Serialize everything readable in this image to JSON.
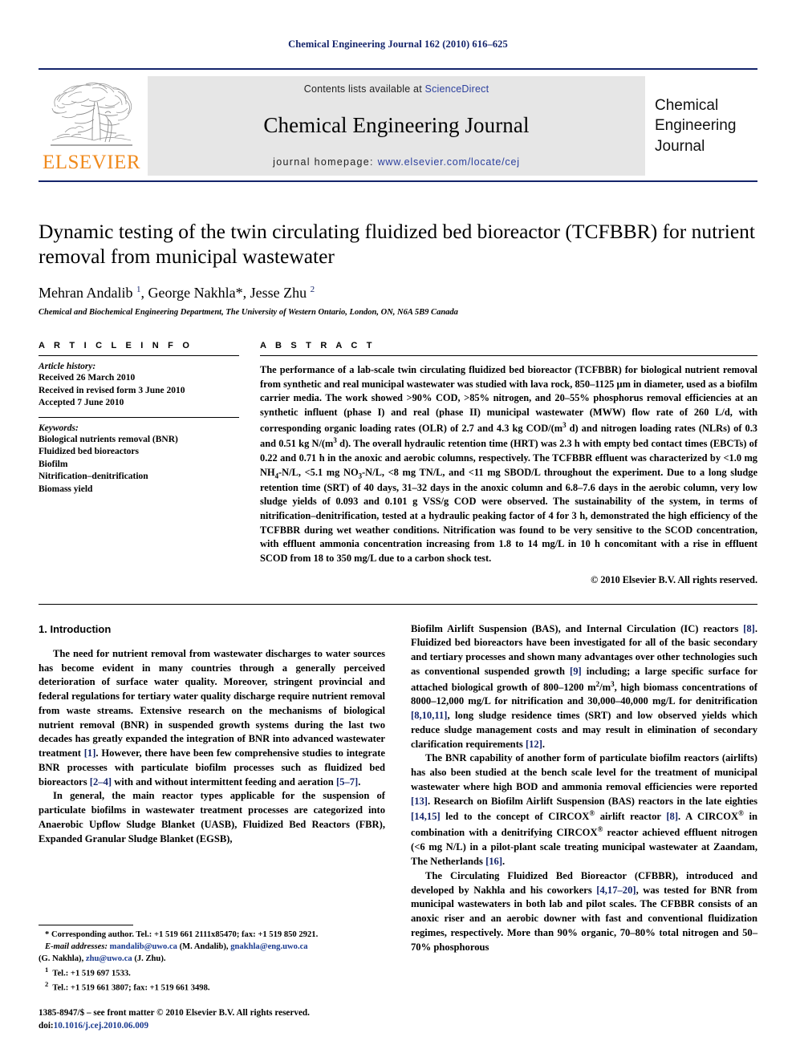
{
  "running_head": "Chemical Engineering Journal 162 (2010) 616–625",
  "masthead": {
    "contents_prefix": "Contents lists available at ",
    "sciencedirect": "ScienceDirect",
    "journal_title": "Chemical Engineering Journal",
    "homepage_prefix": "journal homepage: ",
    "homepage_url": "www.elsevier.com/locate/cej",
    "publisher_wordmark": "ELSEVIER",
    "cover_lines": [
      "Chemical",
      "Engineering",
      "Journal"
    ],
    "link_color": "#2b3f9e",
    "rule_color": "#14246b",
    "band_color": "#e6e6e6",
    "elsevier_orange": "#f08a1c"
  },
  "article": {
    "title": "Dynamic testing of the twin circulating fluidized bed bioreactor (TCFBBR) for nutrient removal from municipal wastewater",
    "authors_html": "Mehran Andalib <sup>1</sup>, George Nakhla<span class=\"star\">*</span>, Jesse Zhu <sup>2</sup>",
    "affiliation": "Chemical and Biochemical Engineering Department, The University of Western Ontario, London, ON, N6A 5B9 Canada"
  },
  "info": {
    "heading": "A R T I C L E    I N F O",
    "history_label": "Article history:",
    "history": [
      "Received 26 March 2010",
      "Received in revised form 3 June 2010",
      "Accepted 7 June 2010"
    ],
    "keywords_label": "Keywords:",
    "keywords": [
      "Biological nutrients removal (BNR)",
      "Fluidized bed bioreactors",
      "Biofilm",
      "Nitrification–denitrification",
      "Biomass yield"
    ]
  },
  "abstract": {
    "heading": "A B S T R A C T",
    "text_html": "The performance of a lab-scale twin circulating fluidized bed bioreactor (TCFBBR) for biological nutrient removal from synthetic and real municipal wastewater was studied with lava rock, 850–1125 μm in diameter, used as a biofilm carrier media. The work showed &gt;90% COD, &gt;85% nitrogen, and 20–55% phosphorus removal efficiencies at an synthetic influent (phase I) and real (phase II) municipal wastewater (MWW) flow rate of 260 L/d, with corresponding organic loading rates (OLR) of 2.7 and 4.3 kg COD/(m<sup class=\"s\">3</sup> d) and nitrogen loading rates (NLRs) of 0.3 and 0.51 kg N/(m<sup class=\"s\">3</sup> d). The overall hydraulic retention time (HRT) was 2.3 h with empty bed contact times (EBCTs) of 0.22 and 0.71 h in the anoxic and aerobic columns, respectively. The TCFBBR effluent was characterized by &lt;1.0 mg NH<sub>4</sub>-N/L, &lt;5.1 mg NO<sub>3</sub>-N/L, &lt;8 mg TN/L, and &lt;11 mg SBOD/L throughout the experiment. Due to a long sludge retention time (SRT) of 40 days, 31–32 days in the anoxic column and 6.8–7.6 days in the aerobic column, very low sludge yields of 0.093 and 0.101 g VSS/g COD were observed. The sustainability of the system, in terms of nitrification–denitrification, tested at a hydraulic peaking factor of 4 for 3 h, demonstrated the high efficiency of the TCFBBR during wet weather conditions. Nitrification was found to be very sensitive to the SCOD concentration, with effluent ammonia concentration increasing from 1.8 to 14 mg/L in 10 h concomitant with a rise in effluent SCOD from 18 to 350 mg/L due to a carbon shock test.",
    "copyright": "© 2010 Elsevier B.V. All rights reserved."
  },
  "body": {
    "section_title": "1.  Introduction",
    "left_paragraphs_html": [
      "The need for nutrient removal from wastewater discharges to water sources has become evident in many countries through a generally perceived deterioration of surface water quality. Moreover, stringent provincial and federal regulations for tertiary water quality discharge require nutrient removal from waste streams. Extensive research on the mechanisms of biological nutrient removal (BNR) in suspended growth systems during the last two decades has greatly expanded the integration of BNR into advanced wastewater treatment <span class=\"cite\">[1]</span>. However, there have been few comprehensive studies to integrate BNR processes with particulate biofilm processes such as fluidized bed bioreactors <span class=\"cite\">[2–4]</span> with and without intermittent feeding and aeration <span class=\"cite\">[5–7]</span>.",
      "In general, the main reactor types applicable for the suspension of particulate biofilms in wastewater treatment processes are categorized into Anaerobic Upflow Sludge Blanket (UASB), Fluidized Bed Reactors (FBR), Expanded Granular Sludge Blanket (EGSB),"
    ],
    "right_paragraphs_html": [
      "Biofilm Airlift Suspension (BAS), and Internal Circulation (IC) reactors <span class=\"cite\">[8]</span>. Fluidized bed bioreactors have been investigated for all of the basic secondary and tertiary processes and shown many advantages over other technologies such as conventional suspended growth <span class=\"cite\">[9]</span> including; a large specific surface for attached biological growth of 800–1200 m<sup class=\"s\">2</sup>/m<sup class=\"s\">3</sup>, high biomass concentrations of 8000–12,000 mg/L for nitrification and 30,000–40,000 mg/L for denitrification <span class=\"cite\">[8,10,11]</span>, long sludge residence times (SRT) and low observed yields which reduce sludge management costs and may result in elimination of secondary clarification requirements <span class=\"cite\">[12]</span>.",
      "The BNR capability of another form of particulate biofilm reactors (airlifts) has also been studied at the bench scale level for the treatment of municipal wastewater where high BOD and ammonia removal efficiencies were reported <span class=\"cite\">[13]</span>. Research on Biofilm Airlift Suspension (BAS) reactors in the late eighties <span class=\"cite\">[14,15]</span> led to the concept of CIRCOX<sup class=\"s\">®</sup> airlift reactor <span class=\"cite\">[8]</span>. A CIRCOX<sup class=\"s\">®</sup> in combination with a denitrifying CIRCOX<sup class=\"s\">®</sup> reactor achieved effluent nitrogen (&lt;6 mg N/L) in a pilot-plant scale treating municipal wastewater at Zaandam, The Netherlands <span class=\"cite\">[16]</span>.",
      "The Circulating Fluidized Bed Bioreactor (CFBBR), introduced and developed by Nakhla and his coworkers <span class=\"cite\">[4,17–20]</span>, was tested for BNR from municipal wastewaters in both lab and pilot scales. The CFBBR consists of an anoxic riser and an aerobic downer with fast and conventional fluidization regimes, respectively. More than 90% organic, 70–80% total nitrogen and 50–70% phosphorous"
    ]
  },
  "footnotes": {
    "corresponding_html": "<span class=\"star\">*</span> Corresponding author. Tel.: +1 519 661 2111x85470; fax: +1 519 850 2921.",
    "email_label": "E-mail addresses:",
    "emails_html": "<span class=\"fn-mail\">mandalib@uwo.ca</span> (M. Andalib), <span class=\"fn-mail\">gnakhla@eng.uwo.ca</span>",
    "emails_cont_html": "(G. Nakhla), <span class=\"fn-mail\">zhu@uwo.ca</span> (J. Zhu).",
    "note1_html": "<span class=\"fnum\">1</span>&nbsp; Tel.: +1 519 697 1533.",
    "note2_html": "<span class=\"fnum\">2</span>&nbsp; Tel.: +1 519 661 3807; fax: +1 519 661 3498.",
    "issn_line": "1385-8947/$ – see front matter © 2010 Elsevier B.V. All rights reserved.",
    "doi_prefix": "doi:",
    "doi_value": "10.1016/j.cej.2010.06.009"
  }
}
